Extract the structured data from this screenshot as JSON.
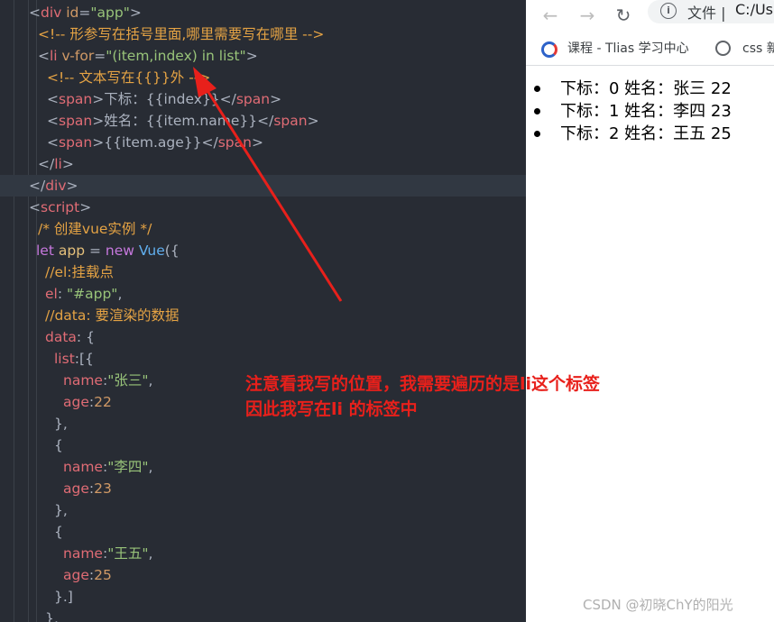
{
  "editor": {
    "lines": [
      {
        "segments": [
          [
            "punc",
            "<"
          ],
          [
            "tag",
            "div"
          ],
          [
            "attr",
            " id"
          ],
          [
            "punc",
            "="
          ],
          [
            "str",
            "\"app\""
          ],
          [
            "punc",
            ">"
          ]
        ]
      },
      {
        "segments": [
          [
            "cmt",
            "<!-- 形参写在括号里面,哪里需要写在哪里 -->"
          ]
        ]
      },
      {
        "segments": [
          [
            "punc",
            "<"
          ],
          [
            "tag",
            "li"
          ],
          [
            "attr",
            " v-for"
          ],
          [
            "punc",
            "="
          ],
          [
            "str",
            "\"(item,index) in list\""
          ],
          [
            "punc",
            ">"
          ]
        ]
      },
      {
        "segments": [
          [
            "cmt",
            "<!-- 文本写在{{}}外 -->"
          ]
        ]
      },
      {
        "segments": [
          [
            "punc",
            "<"
          ],
          [
            "tag",
            "span"
          ],
          [
            "punc",
            ">"
          ],
          [
            "txt",
            "下标：{{index}}"
          ],
          [
            "punc",
            "</"
          ],
          [
            "tag",
            "span"
          ],
          [
            "punc",
            ">"
          ]
        ]
      },
      {
        "segments": [
          [
            "punc",
            "<"
          ],
          [
            "tag",
            "span"
          ],
          [
            "punc",
            ">"
          ],
          [
            "txt",
            "姓名：{{item.name}}"
          ],
          [
            "punc",
            "</"
          ],
          [
            "tag",
            "span"
          ],
          [
            "punc",
            ">"
          ]
        ]
      },
      {
        "segments": [
          [
            "punc",
            "<"
          ],
          [
            "tag",
            "span"
          ],
          [
            "punc",
            ">"
          ],
          [
            "txt",
            "{{item.age}}"
          ],
          [
            "punc",
            "</"
          ],
          [
            "tag",
            "span"
          ],
          [
            "punc",
            ">"
          ]
        ]
      },
      {
        "segments": [
          [
            "punc",
            "</"
          ],
          [
            "tag",
            "li"
          ],
          [
            "punc",
            ">"
          ]
        ]
      },
      {
        "segments": [
          [
            "punc",
            "</"
          ],
          [
            "tag",
            "div"
          ],
          [
            "punc",
            ">"
          ]
        ]
      },
      {
        "segments": [
          [
            "punc",
            "<"
          ],
          [
            "tag",
            "script"
          ],
          [
            "punc",
            ">"
          ]
        ]
      },
      {
        "segments": [
          [
            "cmt2",
            "/* 创建vue实例 */"
          ]
        ]
      },
      {
        "segments": [
          [
            "kw",
            "let"
          ],
          [
            "txt",
            " "
          ],
          [
            "var",
            "app"
          ],
          [
            "txt",
            " = "
          ],
          [
            "kw",
            "new"
          ],
          [
            "txt",
            " "
          ],
          [
            "fn",
            "Vue"
          ],
          [
            "punc",
            "({"
          ]
        ]
      },
      {
        "segments": [
          [
            "cmt2",
            "//el:挂载点"
          ]
        ]
      },
      {
        "segments": [
          [
            "prop",
            "el"
          ],
          [
            "punc",
            ": "
          ],
          [
            "str",
            "\"#app\""
          ],
          [
            "punc",
            ","
          ]
        ]
      },
      {
        "segments": [
          [
            "cmt2",
            "//data: 要渲染的数据"
          ]
        ]
      },
      {
        "segments": [
          [
            "prop",
            "data"
          ],
          [
            "punc",
            ": {"
          ]
        ]
      },
      {
        "segments": [
          [
            "prop",
            "list"
          ],
          [
            "punc",
            ":[{"
          ]
        ]
      },
      {
        "segments": [
          [
            "prop",
            "name"
          ],
          [
            "punc",
            ":"
          ],
          [
            "str",
            "\"张三\""
          ],
          [
            "punc",
            ","
          ]
        ]
      },
      {
        "segments": [
          [
            "prop",
            "age"
          ],
          [
            "punc",
            ":"
          ],
          [
            "num",
            "22"
          ]
        ]
      },
      {
        "segments": [
          [
            "punc",
            "},"
          ]
        ]
      },
      {
        "segments": [
          [
            "punc",
            "{"
          ]
        ]
      },
      {
        "segments": [
          [
            "prop",
            "name"
          ],
          [
            "punc",
            ":"
          ],
          [
            "str",
            "\"李四\""
          ],
          [
            "punc",
            ","
          ]
        ]
      },
      {
        "segments": [
          [
            "prop",
            "age"
          ],
          [
            "punc",
            ":"
          ],
          [
            "num",
            "23"
          ]
        ]
      },
      {
        "segments": [
          [
            "punc",
            "},"
          ]
        ]
      },
      {
        "segments": [
          [
            "punc",
            "{"
          ]
        ]
      },
      {
        "segments": [
          [
            "prop",
            "name"
          ],
          [
            "punc",
            ":"
          ],
          [
            "str",
            "\"王五\""
          ],
          [
            "punc",
            ","
          ]
        ]
      },
      {
        "segments": [
          [
            "prop",
            "age"
          ],
          [
            "punc",
            ":"
          ],
          [
            "num",
            "25"
          ]
        ]
      },
      {
        "segments": [
          [
            "punc",
            "}.]"
          ]
        ]
      },
      {
        "segments": [
          [
            "punc",
            "},"
          ]
        ]
      }
    ]
  },
  "browser": {
    "back_icon": "←",
    "forward_icon": "→",
    "reload_icon": "↻",
    "info_icon": "i",
    "address_label": "文件 |",
    "address_url": "C:/Us",
    "bookmarks": [
      {
        "label": "课程 - Tlias 学习中心",
        "icon": "course-icon"
      },
      {
        "label": "css 新",
        "icon": "globe-icon"
      }
    ],
    "list_items": [
      "下标：0 姓名：张三 22",
      "下标：1 姓名：李四 23",
      "下标：2 姓名：王五 25"
    ]
  },
  "annotation": {
    "line1": "注意看我写的位置，我需要遍历的是li这个标签",
    "line2": "因此我写在li 的标签中",
    "color": "#e8201b"
  },
  "watermark": "CSDN @初晓ChY的阳光"
}
